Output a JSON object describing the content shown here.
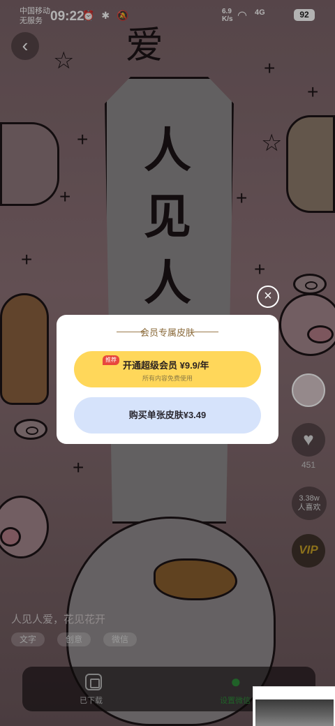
{
  "status_bar": {
    "carrier_line1": "中国移动",
    "carrier_line2": "无服务",
    "time": "09:22",
    "status_icons": "⏰ ✱ 🔕",
    "net_speed_value": "6.9",
    "net_speed_unit": "K/s",
    "signal": "4G",
    "battery": "92"
  },
  "wallpaper": {
    "banner_chars": [
      "人",
      "见",
      "人"
    ],
    "top_script": "爱"
  },
  "side": {
    "like_count": "451",
    "favs_count": "3.38w",
    "favs_label": "人喜欢",
    "vip_label": "VIP"
  },
  "content": {
    "caption": "人见人爱，花见花开",
    "tags": [
      "文字",
      "创意",
      "微信"
    ]
  },
  "bottom_bar": {
    "download_label": "已下载",
    "set_label": "设置微信"
  },
  "dialog": {
    "title": "会员专属皮肤",
    "vip_badge": "推荐",
    "vip_label": "开通超级会员 ¥9.9/年",
    "vip_sub": "所有内容免费使用",
    "single_label": "购买单张皮肤¥3.49",
    "close": "×"
  },
  "colors": {
    "vip_button": "#ffd75a",
    "single_button": "#d6e3fb",
    "badge": "#e8473d",
    "accent_green": "#2e8b3a"
  }
}
